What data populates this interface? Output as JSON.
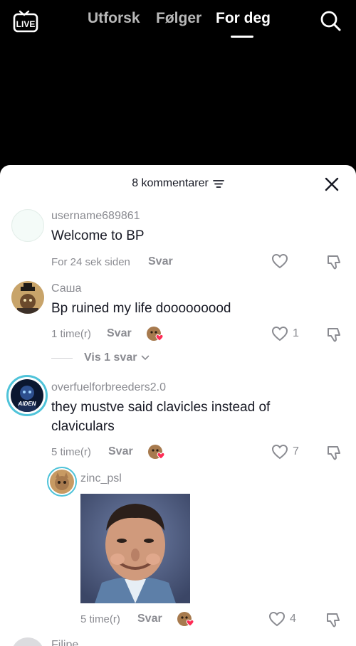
{
  "nav": {
    "live_label": "LIVE",
    "tabs": [
      {
        "label": "Utforsk",
        "active": false
      },
      {
        "label": "Følger",
        "active": false
      },
      {
        "label": "For deg",
        "active": true
      }
    ]
  },
  "sheet": {
    "comment_count_label": "8 kommentarer"
  },
  "comments": [
    {
      "username": "username689861",
      "text": "Welcome to BP",
      "time": "For 24 sek siden",
      "reply_label": "Svar",
      "likes": ""
    },
    {
      "username": "Саша",
      "text": "Bp ruined my life dooooooood",
      "time": "1 time(r)",
      "reply_label": "Svar",
      "likes": "1",
      "view_replies": "Vis 1 svar"
    },
    {
      "username": "overfuelforbreeders2.0",
      "text": "they mustve said clavicles instead of claviculars",
      "time": "5 time(r)",
      "reply_label": "Svar",
      "likes": "7",
      "avatar_text": "AIDEN"
    },
    {
      "username": "zinc_psl",
      "time": "5 time(r)",
      "reply_label": "Svar",
      "likes": "4"
    },
    {
      "username": "Filipe"
    }
  ],
  "colors": {
    "muted_text": "#8a8b91",
    "primary_text": "#161823",
    "heart_badge": "#fe2c55",
    "story_ring": "#26c6da"
  }
}
